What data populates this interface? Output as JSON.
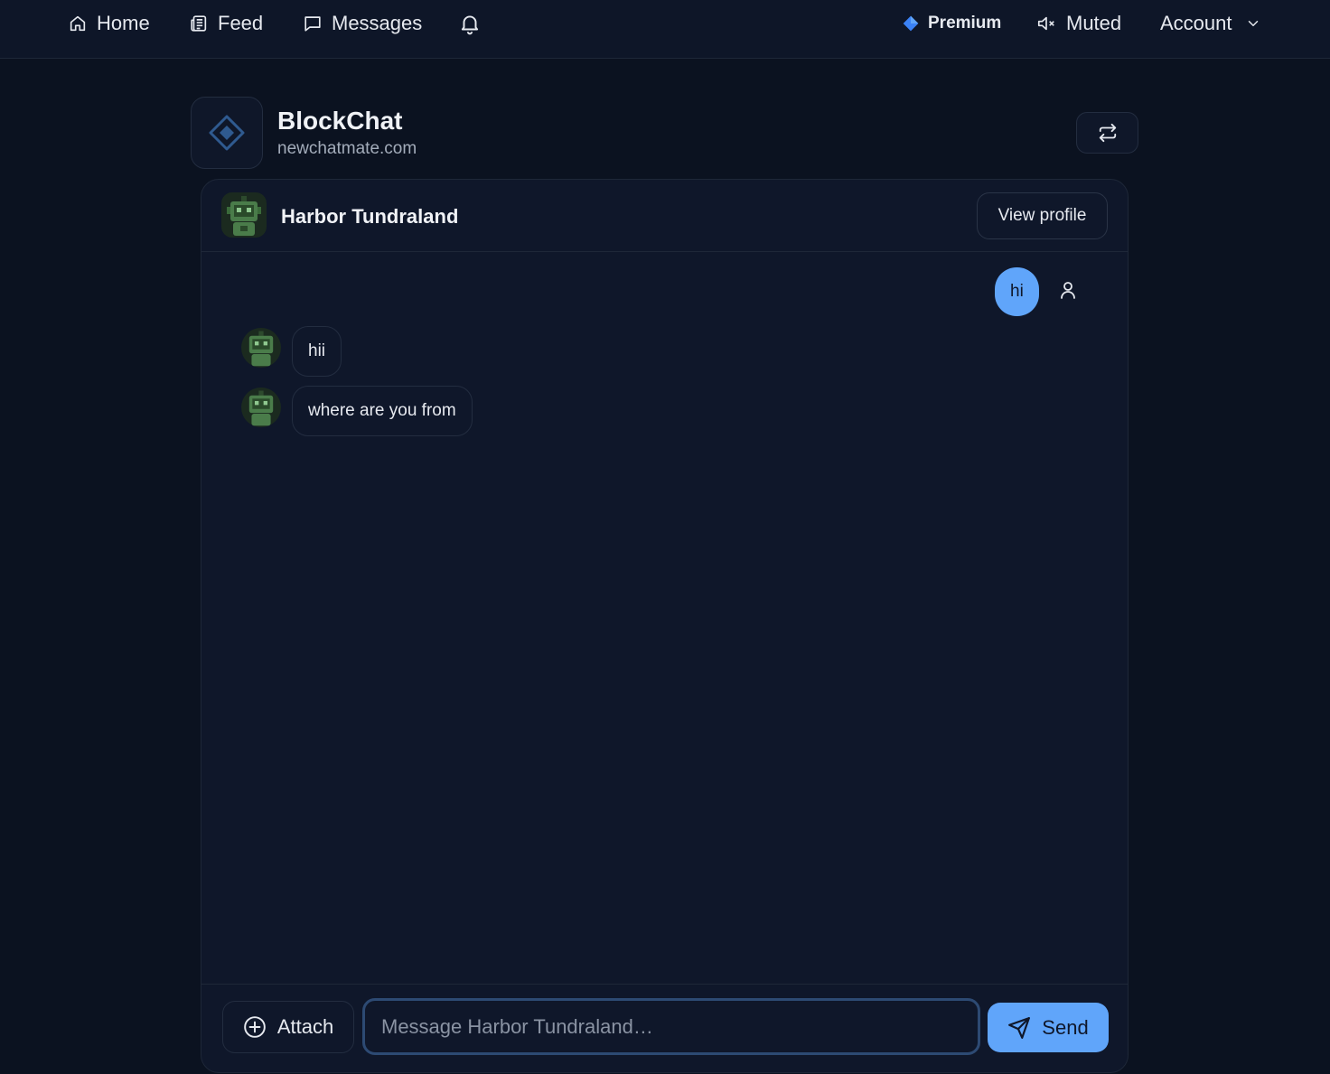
{
  "nav": {
    "home_label": "Home",
    "feed_label": "Feed",
    "messages_label": "Messages",
    "premium_label": "Premium",
    "muted_label": "Muted",
    "account_label": "Account"
  },
  "brand": {
    "name": "BlockChat",
    "domain": "newchatmate.com"
  },
  "chat": {
    "contact_name": "Harbor Tundraland",
    "view_profile_label": "View profile",
    "messages": [
      {
        "direction": "outgoing",
        "text": "hi"
      },
      {
        "direction": "incoming",
        "text": "hii"
      },
      {
        "direction": "incoming",
        "text": "where are you from"
      }
    ]
  },
  "composer": {
    "attach_label": "Attach",
    "placeholder": "Message Harbor Tundraland…",
    "send_label": "Send"
  },
  "colors": {
    "background": "#0b1220",
    "panel": "#0f172a",
    "accent": "#60a5fa",
    "premium_diamond": "#3b82f6",
    "avatar_green": "#4a7c4a"
  },
  "icons": {
    "nav": [
      "home-icon",
      "feed-icon",
      "messages-icon",
      "bell-icon",
      "diamond-icon",
      "muted-speaker-icon",
      "chevron-down-icon"
    ],
    "brand": "diamond-logo-icon",
    "switch": "swap-arrows-icon",
    "self": "user-icon",
    "attach": "plus-circle-icon",
    "send": "paper-plane-icon"
  }
}
